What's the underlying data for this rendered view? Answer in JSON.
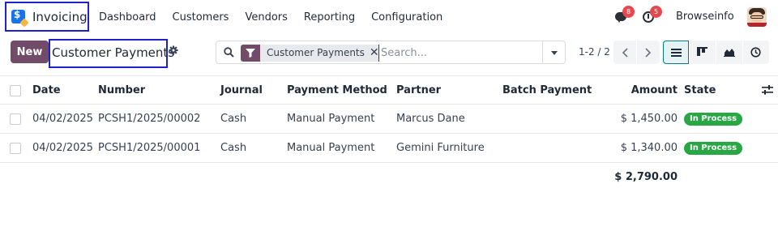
{
  "topnav": {
    "app_name": "Invoicing",
    "menu": [
      "Dashboard",
      "Customers",
      "Vendors",
      "Reporting",
      "Configuration"
    ],
    "chat_badge": "8",
    "activity_badge": "5",
    "company": "Browseinfo",
    "colors": {
      "brand_border": "#1e22c8"
    }
  },
  "control": {
    "new_label": "New",
    "title": "Customer Payments",
    "search": {
      "facet_label": "Customer Payments",
      "facet_close": "✕",
      "placeholder": "Search..."
    },
    "pager": "1-2 / 2",
    "colors": {
      "primary": "#714b67",
      "active_view": "#017e84"
    }
  },
  "table": {
    "columns": [
      "Date",
      "Number",
      "Journal",
      "Payment Method",
      "Partner",
      "Batch Payment",
      "Amount",
      "State"
    ],
    "rows": [
      {
        "date": "04/02/2025",
        "number": "PCSH1/2025/00002",
        "journal": "Cash",
        "method": "Manual Payment",
        "partner": "Marcus Dane",
        "batch": "",
        "amount": "$ 1,450.00",
        "state": "In Process"
      },
      {
        "date": "04/02/2025",
        "number": "PCSH1/2025/00001",
        "journal": "Cash",
        "method": "Manual Payment",
        "partner": "Gemini Furniture",
        "batch": "",
        "amount": "$ 1,340.00",
        "state": "In Process"
      }
    ],
    "total": "$ 2,790.00",
    "colors": {
      "state_badge": "#28a745"
    }
  }
}
